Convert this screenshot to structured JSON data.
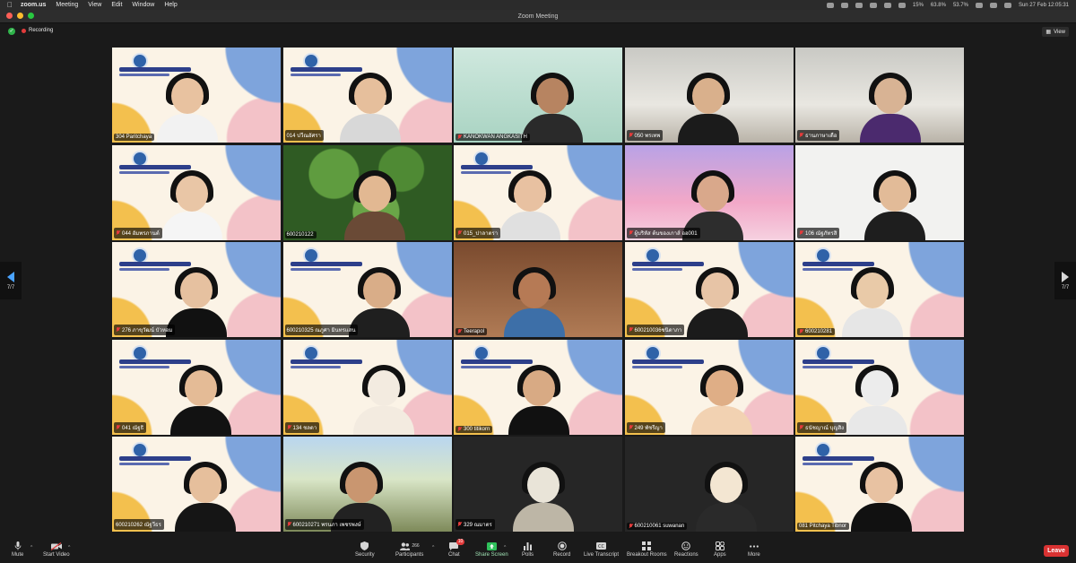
{
  "menubar": {
    "app": "zoom.us",
    "items": [
      "Meeting",
      "View",
      "Edit",
      "Window",
      "Help"
    ],
    "status": [
      "15%",
      "63.8%",
      "53.7%"
    ],
    "datetime": "Sun 27 Feb  12:05:31"
  },
  "window": {
    "title": "Zoom Meeting"
  },
  "infobar": {
    "recording": "Recording",
    "view": "View"
  },
  "pager": {
    "left": "7/7",
    "right": "7/7"
  },
  "participants": [
    {
      "name": "304 Paritchaya",
      "bg": "banner",
      "skin": "#e8c2a0",
      "shirt": "#f2f2f2",
      "muted": false
    },
    {
      "name": "014 ปวีณอัศรา",
      "bg": "banner",
      "skin": "#e6bf9c",
      "shirt": "#d8d8d8",
      "muted": false
    },
    {
      "name": "KANOKWAN ANGKASITH",
      "bg": "mint",
      "skin": "#b78461",
      "shirt": "#2a2a2a",
      "muted": true
    },
    {
      "name": "050 พรเทพ",
      "bg": "room",
      "skin": "#d9b08c",
      "shirt": "#1b1b1b",
      "muted": true
    },
    {
      "name": "ธานภาษาเดือ",
      "bg": "room",
      "skin": "#d8b394",
      "shirt": "#4b2a6e",
      "muted": true
    },
    {
      "name": "044 อัมพรภานต์",
      "bg": "banner",
      "skin": "#e9c6a6",
      "shirt": "#f5f5f5",
      "muted": true
    },
    {
      "name": "600210122",
      "bg": "leaves",
      "skin": "#e2b892",
      "shirt": "#6a4a36",
      "muted": false
    },
    {
      "name": "015_ปาลาตรา",
      "bg": "banner",
      "skin": "#e8c1a1",
      "shirt": "#e0e0e0",
      "muted": true
    },
    {
      "name": "ผู้บริหัส ต้นของเกาส์ ออ001",
      "bg": "pink",
      "skin": "#d9a88b",
      "shirt": "#2d2d2d",
      "muted": true
    },
    {
      "name": "106 ณัฐภัทรสิ",
      "bg": "white",
      "skin": "#e2bb98",
      "shirt": "#1e1e1e",
      "muted": true
    },
    {
      "name": "276 ภาขุวัฒน์ บัวหอม",
      "bg": "banner",
      "skin": "#e6c1a0",
      "shirt": "#111111",
      "muted": true
    },
    {
      "name": "600210325 ณภูศา มินทรแสน",
      "bg": "banner",
      "skin": "#d9ad88",
      "shirt": "#1f1f1f",
      "muted": false
    },
    {
      "name": "Teerapol",
      "bg": "warm",
      "skin": "#b67a55",
      "shirt": "#3d6fa8",
      "muted": true
    },
    {
      "name": "600210036ชนิดาภา",
      "bg": "banner",
      "skin": "#e7c4a6",
      "shirt": "#1b1b1b",
      "muted": true
    },
    {
      "name": "600210281",
      "bg": "banner",
      "skin": "#e9caa8",
      "shirt": "#e6e6e6",
      "muted": true
    },
    {
      "name": "041 ณัฐธิ",
      "bg": "banner",
      "skin": "#e4bb96",
      "shirt": "#121212",
      "muted": true
    },
    {
      "name": "134 ชลดา",
      "bg": "banner",
      "skin": "#f3ebe0",
      "shirt": "#f3ebe0",
      "muted": true
    },
    {
      "name": "300 titikorn",
      "bg": "banner",
      "skin": "#d8aa84",
      "shirt": "#111111",
      "muted": true
    },
    {
      "name": "249 พัชรีญา",
      "bg": "banner",
      "skin": "#dfae86",
      "shirt": "#f2d2b2",
      "muted": true
    },
    {
      "name": "ธนัชญาณ์ บุญสิง",
      "bg": "banner",
      "skin": "#ececec",
      "shirt": "#e8e8e8",
      "muted": true
    },
    {
      "name": "600210262 ณัฐวีธร",
      "bg": "banner",
      "skin": "#e6bf9c",
      "shirt": "#151515",
      "muted": false
    },
    {
      "name": "600210271 พรนภา เพชรพงษ์",
      "bg": "outdoor",
      "skin": "#c99670",
      "shirt": "#222222",
      "muted": true
    },
    {
      "name": "329 ณมาตร",
      "bg": "dark",
      "skin": "#e9e4d8",
      "shirt": "#bdb6a6",
      "muted": true
    },
    {
      "name": "600210061 suwanan",
      "bg": "dark",
      "skin": "#f3e6d2",
      "shirt": "#2a2a2a",
      "muted": true
    },
    {
      "name": "081 Pitchaya Tibnor",
      "bg": "banner",
      "skin": "#e8c2a2",
      "shirt": "#111111",
      "muted": false
    }
  ],
  "toolbar": {
    "mute": "Mute",
    "start_video": "Start Video",
    "security": "Security",
    "participants": "Participants",
    "participants_count": "266",
    "chat": "Chat",
    "chat_badge": "10",
    "share_screen": "Share Screen",
    "polls": "Polls",
    "record": "Record",
    "live_transcript": "Live Transcript",
    "breakout_rooms": "Breakout Rooms",
    "reactions": "Reactions",
    "apps": "Apps",
    "more": "More",
    "leave": "Leave",
    "share_color": "#2fc15b",
    "leave_color": "#d93232"
  }
}
